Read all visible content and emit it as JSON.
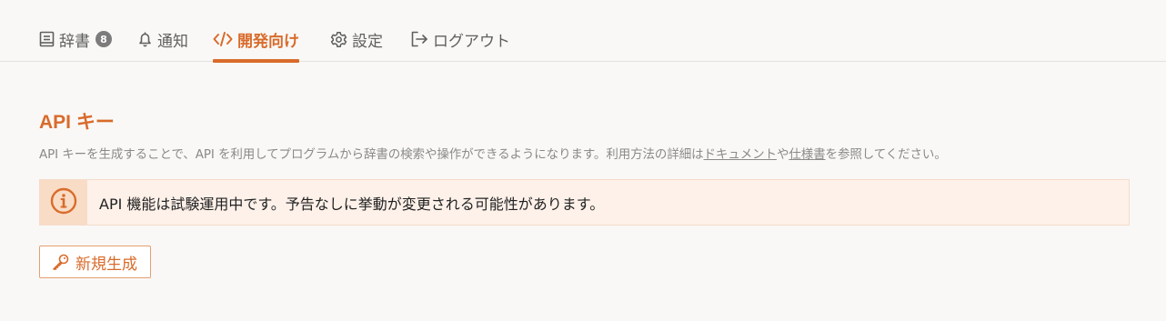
{
  "nav": {
    "dictionary": {
      "label": "辞書",
      "badge": "8",
      "icon": "book-icon"
    },
    "notifications": {
      "label": "通知",
      "icon": "bell-icon"
    },
    "developer": {
      "label": "開発向け",
      "icon": "code-icon",
      "active": true
    },
    "settings": {
      "label": "設定",
      "icon": "gear-icon"
    },
    "logout": {
      "label": "ログアウト",
      "icon": "logout-icon"
    }
  },
  "api_section": {
    "title": "API キー",
    "description_before": "API キーを生成することで、API を利用してプログラムから辞書の検索や操作ができるようになります。利用方法の詳細は",
    "docs_link": "ドキュメント",
    "description_middle": "や",
    "spec_link": "仕様書",
    "description_after": "を参照してください。",
    "alert_icon": "info-circle-icon",
    "alert_text": "API 機能は試験運用中です。予告なしに挙動が変更される可能性があります。",
    "generate_button": {
      "label": "新規生成",
      "icon": "key-icon"
    }
  },
  "colors": {
    "accent": "#d96b2b",
    "alert_background": "#fdf1e9",
    "alert_icon_background": "#f8dcc6",
    "page_background": "#f9f8f6"
  }
}
